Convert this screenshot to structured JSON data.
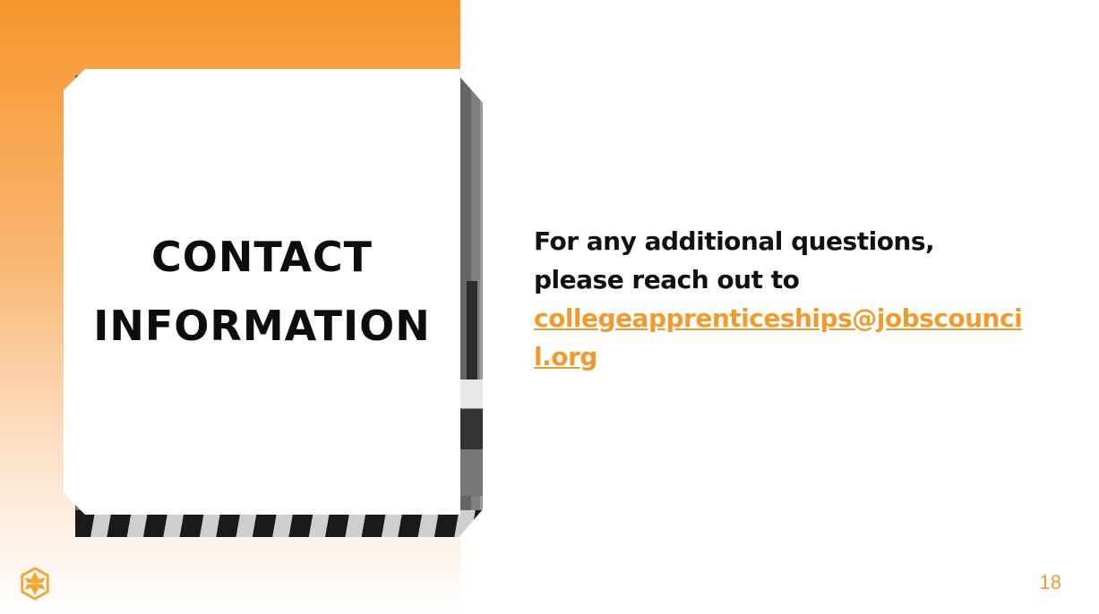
{
  "slide": {
    "title_line1": "CONTACT",
    "title_line2": "INFORMATION",
    "message_line1": "For any additional questions,",
    "message_line2": "please reach out to",
    "email": "collegeapprenticeships@jobscouncil.org",
    "page_number": "18"
  },
  "colors": {
    "accent": "#f39a2d",
    "text": "#111111",
    "panel": "#f7962c"
  },
  "icons": {
    "logo": "hexagon-flower-logo-icon"
  }
}
